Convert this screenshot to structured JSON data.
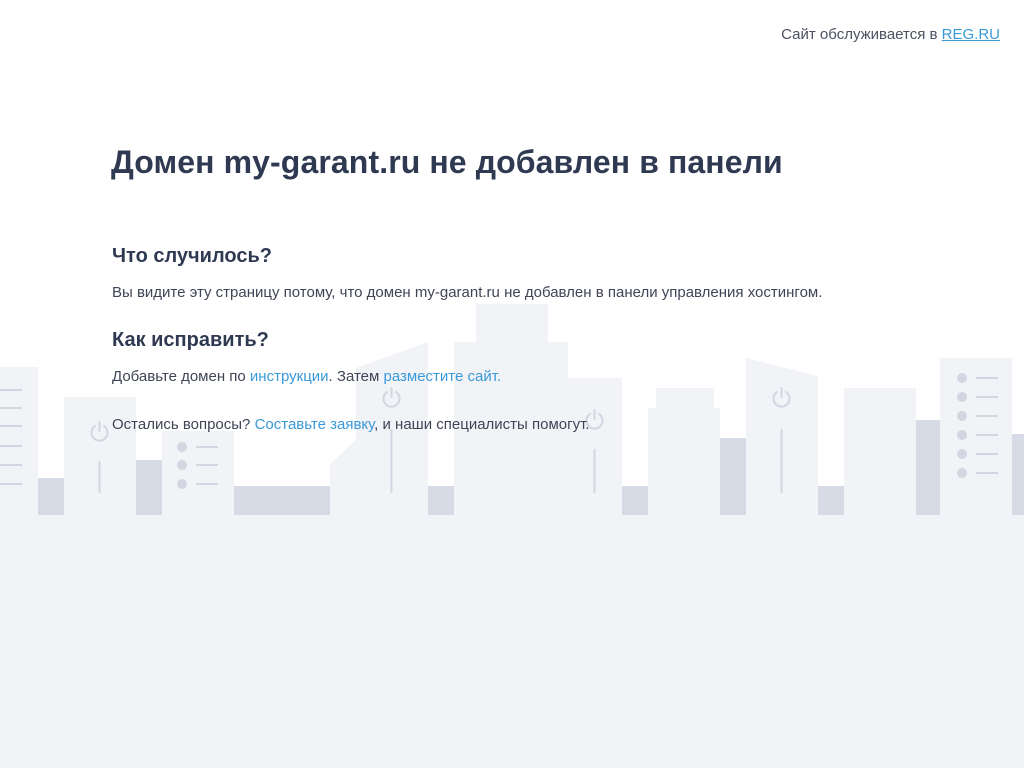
{
  "topbar": {
    "prefix": "Сайт обслуживается в",
    "link": "REG.RU"
  },
  "main": {
    "title": "Домен my-garant.ru не добавлен в панели",
    "what_heading": "Что случилось?",
    "what_text": "Вы видите эту страницу потому, что домен my-garant.ru не добавлен в панели управления хостингом.",
    "how_heading": "Как исправить?",
    "how_text_1": "Добавьте домен по ",
    "how_link_1": "инструкции",
    "how_text_2": ". Затем ",
    "how_link_2": "разместите сайт.",
    "q_text_1": "Остались вопросы? ",
    "q_link": "Составьте заявку",
    "q_text_2": ", и наши специалисты помогут."
  },
  "colors": {
    "accent": "#3a9ad9",
    "heading": "#2f3a52",
    "skyline_light": "#f2f3f7",
    "skyline_dark": "#d7dbe5",
    "skyline_icon": "#d2d6e0"
  },
  "icons": [
    "power-icon",
    "list-icon"
  ]
}
